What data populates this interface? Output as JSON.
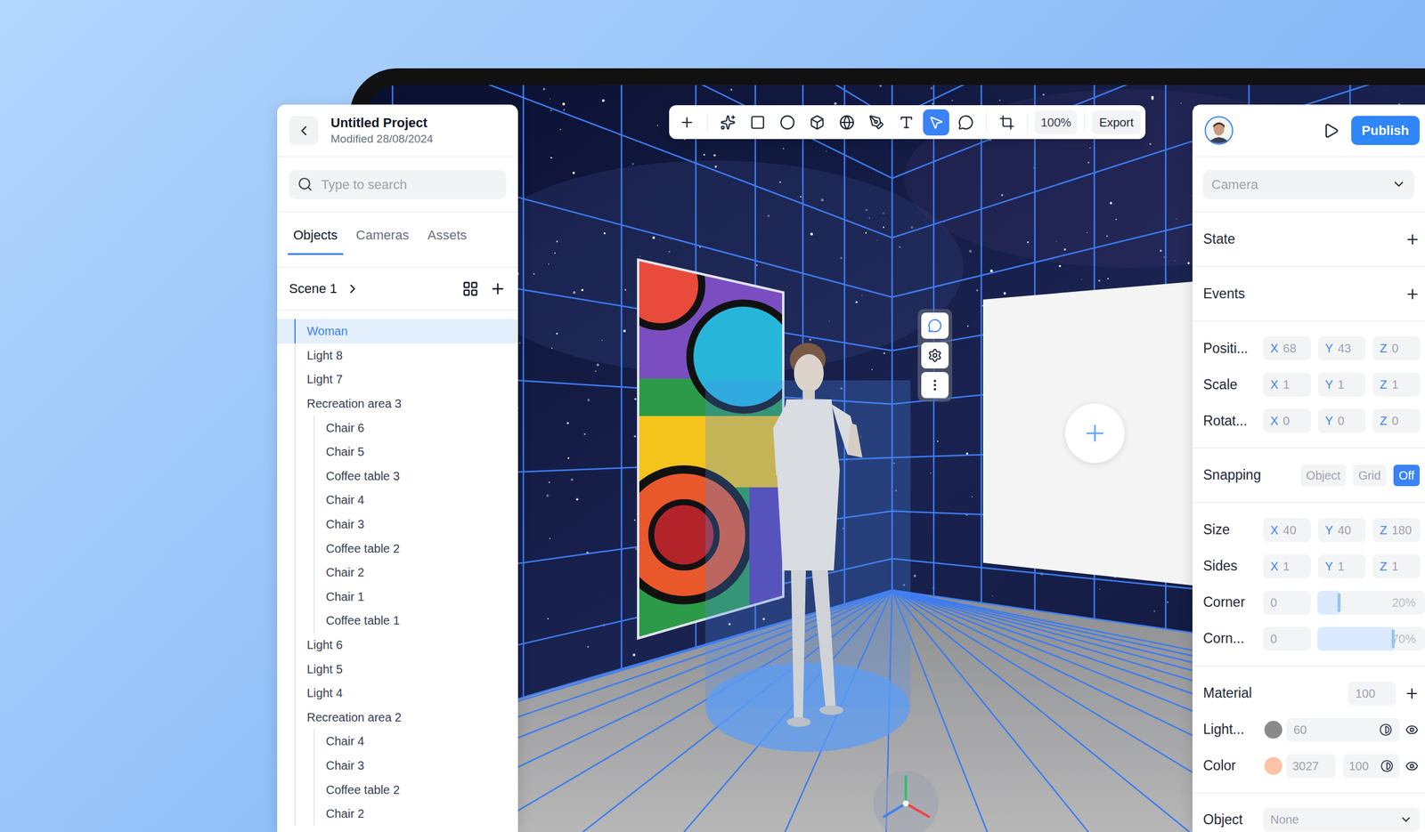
{
  "project": {
    "title": "Untitled Project",
    "modified": "Modified 28/08/2024"
  },
  "search": {
    "placeholder": "Type to search"
  },
  "tabs": [
    {
      "label": "Objects",
      "selected": true
    },
    {
      "label": "Cameras",
      "selected": false
    },
    {
      "label": "Assets",
      "selected": false
    }
  ],
  "scene": {
    "label": "Scene 1"
  },
  "tree": [
    {
      "label": "Woman",
      "level": 1,
      "selected": true
    },
    {
      "label": "Light 8",
      "level": 1,
      "selected": false
    },
    {
      "label": "Light 7",
      "level": 1,
      "selected": false
    },
    {
      "label": "Recreation area 3",
      "level": 1,
      "selected": false
    },
    {
      "label": "Chair 6",
      "level": 2,
      "selected": false
    },
    {
      "label": "Chair 5",
      "level": 2,
      "selected": false
    },
    {
      "label": "Coffee table 3",
      "level": 2,
      "selected": false
    },
    {
      "label": "Chair 4",
      "level": 2,
      "selected": false
    },
    {
      "label": "Chair 3",
      "level": 2,
      "selected": false
    },
    {
      "label": "Coffee table 2",
      "level": 2,
      "selected": false
    },
    {
      "label": "Chair 2",
      "level": 2,
      "selected": false
    },
    {
      "label": "Chair 1",
      "level": 2,
      "selected": false
    },
    {
      "label": "Coffee table 1",
      "level": 2,
      "selected": false
    },
    {
      "label": "Light 6",
      "level": 1,
      "selected": false
    },
    {
      "label": "Light 5",
      "level": 1,
      "selected": false
    },
    {
      "label": "Light 4",
      "level": 1,
      "selected": false
    },
    {
      "label": "Recreation area 2",
      "level": 1,
      "selected": false
    },
    {
      "label": "Chair 4",
      "level": 2,
      "selected": false
    },
    {
      "label": "Chair 3",
      "level": 2,
      "selected": false
    },
    {
      "label": "Coffee table 2",
      "level": 2,
      "selected": false
    },
    {
      "label": "Chair 2",
      "level": 2,
      "selected": false
    }
  ],
  "toolbar": {
    "tools": [
      {
        "kind": "add",
        "selected": false
      },
      {
        "kind": "ai",
        "selected": false
      },
      {
        "kind": "rectangle",
        "selected": false
      },
      {
        "kind": "ellipse",
        "selected": false
      },
      {
        "kind": "cube",
        "selected": false
      },
      {
        "kind": "sphere",
        "selected": false
      },
      {
        "kind": "pen",
        "selected": false
      },
      {
        "kind": "text",
        "selected": false
      },
      {
        "kind": "select",
        "selected": true
      },
      {
        "kind": "comment",
        "selected": false
      },
      {
        "kind": "crop",
        "selected": false
      }
    ],
    "zoom": "100%",
    "export": "Export"
  },
  "object_actions": [
    {
      "kind": "comment",
      "selected": true
    },
    {
      "kind": "settings",
      "selected": false
    },
    {
      "kind": "more",
      "selected": false
    }
  ],
  "inspector": {
    "publish": "Publish",
    "camera": {
      "placeholder": "Camera"
    },
    "sections": [
      {
        "label": "State"
      },
      {
        "label": "Events"
      }
    ],
    "transform": [
      {
        "label": "Positi...",
        "fields": [
          {
            "axis": "X",
            "value": "68"
          },
          {
            "axis": "Y",
            "value": "43"
          },
          {
            "axis": "Z",
            "value": "0"
          }
        ]
      },
      {
        "label": "Scale",
        "fields": [
          {
            "axis": "X",
            "value": "1"
          },
          {
            "axis": "Y",
            "value": "1"
          },
          {
            "axis": "Z",
            "value": "1"
          }
        ]
      },
      {
        "label": "Rotat...",
        "fields": [
          {
            "axis": "X",
            "value": "0"
          },
          {
            "axis": "Y",
            "value": "0"
          },
          {
            "axis": "Z",
            "value": "0"
          }
        ]
      }
    ],
    "snapping": {
      "label": "Snapping",
      "options": [
        {
          "label": "Object",
          "selected": false
        },
        {
          "label": "Grid",
          "selected": false
        },
        {
          "label": "Off",
          "selected": true
        }
      ]
    },
    "dimensions": [
      {
        "label": "Size",
        "fields": [
          {
            "axis": "X",
            "value": "40"
          },
          {
            "axis": "Y",
            "value": "40"
          },
          {
            "axis": "Z",
            "value": "180"
          }
        ]
      },
      {
        "label": "Sides",
        "fields": [
          {
            "axis": "X",
            "value": "1"
          },
          {
            "axis": "Y",
            "value": "1"
          },
          {
            "axis": "Z",
            "value": "1"
          }
        ]
      }
    ],
    "corners": [
      {
        "label": "Corner",
        "value": "0",
        "reading": "20%",
        "level": 0.2
      },
      {
        "label": "Corn...",
        "value": "0",
        "reading": "70%",
        "level": 0.7
      }
    ],
    "material": {
      "label": "Material",
      "value": "100"
    },
    "light": {
      "label": "Light...",
      "value": "60",
      "swatch": "#8a8a8a",
      "visible": true
    },
    "color": {
      "label": "Color",
      "value": "3027",
      "opacity": "100",
      "swatch": "#fcc3a6",
      "visible": true
    },
    "object": {
      "label": "Object",
      "value": "None"
    }
  }
}
